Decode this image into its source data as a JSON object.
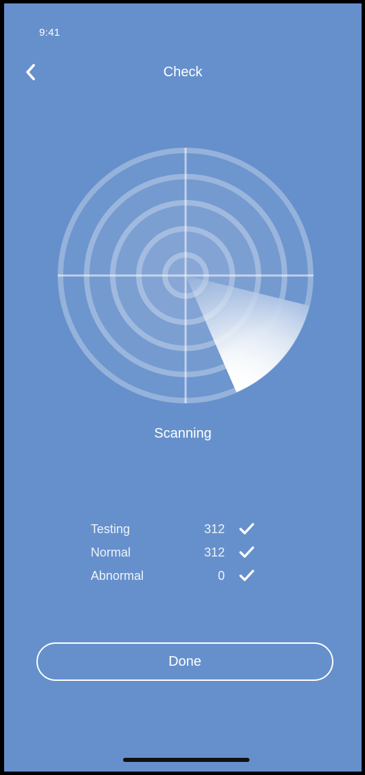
{
  "status_bar": {
    "time": "9:41"
  },
  "header": {
    "back_icon": "chevron-left-icon",
    "title": "Check"
  },
  "radar": {
    "icon": "radar-scan-icon"
  },
  "scan_status": "Scanning",
  "stats": [
    {
      "label": "Testing",
      "value": "312",
      "icon": "checkmark-icon"
    },
    {
      "label": "Normal",
      "value": "312",
      "icon": "checkmark-icon"
    },
    {
      "label": "Abnormal",
      "value": "0",
      "icon": "checkmark-icon"
    }
  ],
  "done_button": {
    "label": "Done"
  },
  "colors": {
    "background": "#6690cc",
    "foreground": "#ffffff"
  }
}
